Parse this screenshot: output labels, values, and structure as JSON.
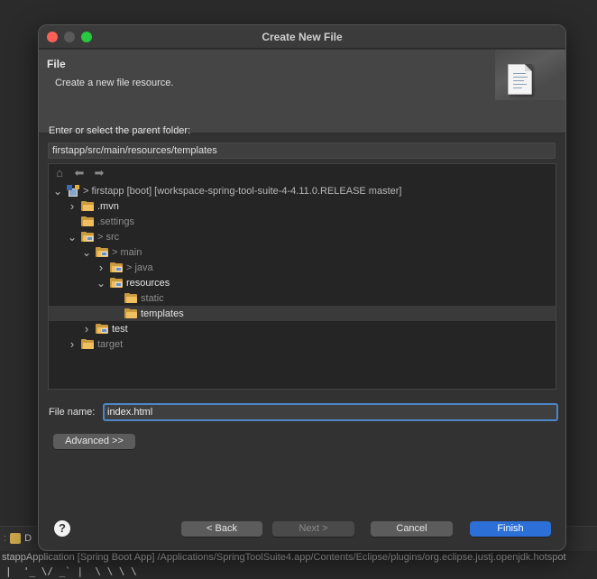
{
  "dialog": {
    "title": "Create New File",
    "banner": {
      "title": "File",
      "description": "Create a new file resource."
    },
    "parent_label": "Enter or select the parent folder:",
    "parent_path": "firstapp/src/main/resources/templates",
    "tree": [
      {
        "twisty": "expanded",
        "icon": "project-icon",
        "label": "> firstapp [boot] [workspace-spring-tool-suite-4-4.11.0.RELEASE master]",
        "state": "project",
        "level": 0
      },
      {
        "twisty": "collapsed",
        "icon": "folder-icon",
        "label": ".mvn",
        "state": "normal",
        "level": 1
      },
      {
        "twisty": "none",
        "icon": "folder-icon",
        "label": ".settings",
        "state": "dim",
        "level": 1
      },
      {
        "twisty": "expanded",
        "icon": "package-folder-icon",
        "label": "> src",
        "state": "dim",
        "level": 1
      },
      {
        "twisty": "expanded",
        "icon": "package-folder-icon",
        "label": "> main",
        "state": "dim",
        "level": 2
      },
      {
        "twisty": "collapsed",
        "icon": "package-folder-icon",
        "label": "> java",
        "state": "dim",
        "level": 3
      },
      {
        "twisty": "expanded",
        "icon": "package-folder-icon",
        "label": "resources",
        "state": "normal",
        "level": 3
      },
      {
        "twisty": "none",
        "icon": "folder-icon",
        "label": "static",
        "state": "dim",
        "level": 4
      },
      {
        "twisty": "none",
        "icon": "folder-icon",
        "label": "templates",
        "state": "selected",
        "level": 4
      },
      {
        "twisty": "collapsed",
        "icon": "package-folder-icon",
        "label": "test",
        "state": "normal",
        "level": 2
      },
      {
        "twisty": "collapsed",
        "icon": "folder-icon",
        "label": "target",
        "state": "dim",
        "level": 1
      }
    ],
    "file_name_label": "File name:",
    "file_name_value": "index.html",
    "advanced_label": "Advanced >>",
    "buttons": {
      "back": "< Back",
      "next": "Next >",
      "cancel": "Cancel",
      "finish": "Finish"
    },
    "help_glyph": "?"
  },
  "background": {
    "tab_label": "D",
    "console_line": "stappApplication [Spring Boot App] /Applications/SpringToolSuite4.app/Contents/Eclipse/plugins/org.eclipse.justj.openjdk.hotspot",
    "ascii_line": "|  '_ \\/ _` |  \\ \\ \\ \\"
  },
  "colors": {
    "accent": "#2c6fd6",
    "folder": "#f0c060",
    "close": "#fe5f57",
    "maximize": "#28c840"
  }
}
